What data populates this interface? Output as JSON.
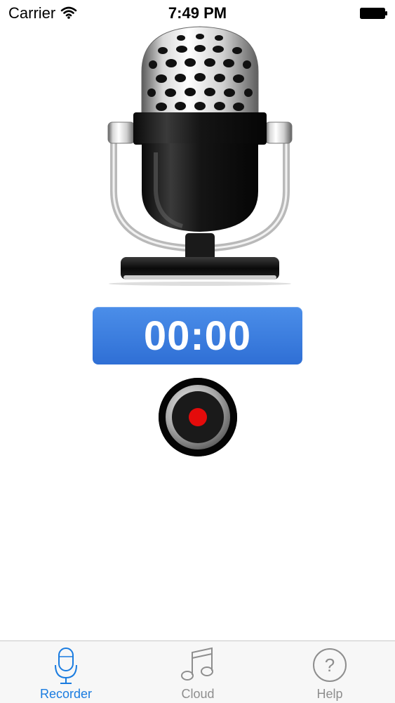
{
  "status_bar": {
    "carrier": "Carrier",
    "time": "7:49 PM"
  },
  "recorder": {
    "timer": "00:00",
    "record_button_color": "#e40b0b"
  },
  "tab_bar": {
    "active_color": "#1a7ce0",
    "inactive_color": "#8e8e8e",
    "tabs": [
      {
        "label": "Recorder",
        "icon": "microphone-icon",
        "active": true
      },
      {
        "label": "Cloud",
        "icon": "music-note-icon",
        "active": false
      },
      {
        "label": "Help",
        "icon": "help-circle-icon",
        "active": false
      }
    ]
  }
}
